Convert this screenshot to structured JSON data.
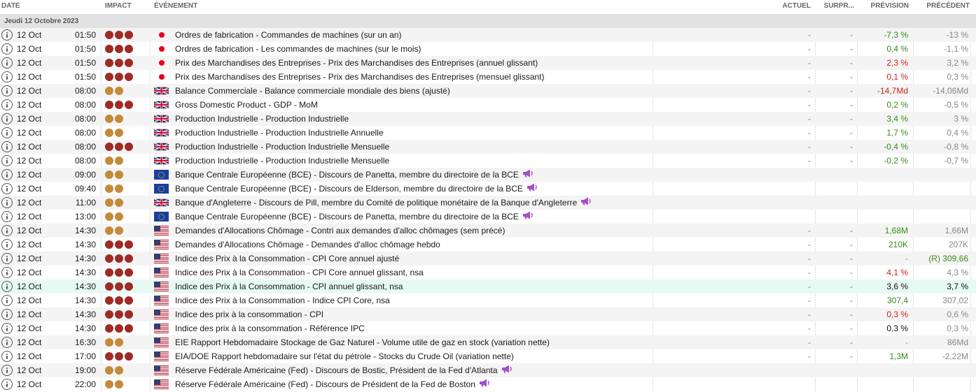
{
  "header": {
    "date": "DATE",
    "impact": "IMPACT",
    "event": "ÉVÉNEMENT",
    "actual": "ACTUEL",
    "surprise": "SURPR...",
    "forecast": "PRÉVISION",
    "previous": "PRÉCÉDENT"
  },
  "day_label": "Jeudi 12 Octobre 2023",
  "colors": {
    "impact_high": "#9e2b25",
    "impact_medium": "#c48a3a",
    "positive": "#3a8b19",
    "negative": "#d0211b",
    "speech_icon": "#a64ec8",
    "highlight_row": "#e6faf3"
  },
  "events": [
    {
      "date": "12 Oct",
      "time": "01:50",
      "impact": 3,
      "flag": "jp",
      "event": "Ordres de fabrication - Commandes de machines (sur un an)",
      "speech": false,
      "actual": "-",
      "surprise": "-",
      "forecast": "-7,3 %",
      "forecast_tone": "pos",
      "previous": "-13 %",
      "previous_tone": "muted"
    },
    {
      "date": "12 Oct",
      "time": "01:50",
      "impact": 3,
      "flag": "jp",
      "event": "Ordres de fabrication - Les commandes de machines (sur le mois)",
      "speech": false,
      "actual": "-",
      "surprise": "-",
      "forecast": "0,4 %",
      "forecast_tone": "pos",
      "previous": "-1,1 %",
      "previous_tone": "muted"
    },
    {
      "date": "12 Oct",
      "time": "01:50",
      "impact": 3,
      "flag": "jp",
      "event": "Prix des Marchandises des Entreprises - Prix des Marchandises des Entreprises (annuel glissant)",
      "speech": false,
      "actual": "-",
      "surprise": "-",
      "forecast": "2,3 %",
      "forecast_tone": "neg",
      "previous": "3,2 %",
      "previous_tone": "muted"
    },
    {
      "date": "12 Oct",
      "time": "01:50",
      "impact": 3,
      "flag": "jp",
      "event": "Prix des Marchandises des Entreprises - Prix des Marchandises des Entreprises (mensuel glissant)",
      "speech": false,
      "actual": "-",
      "surprise": "-",
      "forecast": "0,1 %",
      "forecast_tone": "neg",
      "previous": "0,3 %",
      "previous_tone": "muted"
    },
    {
      "date": "12 Oct",
      "time": "08:00",
      "impact": 2,
      "flag": "uk",
      "event": "Balance Commerciale - Balance commerciale mondiale des biens (ajusté)",
      "speech": false,
      "actual": "-",
      "surprise": "-",
      "forecast": "-14,7Md",
      "forecast_tone": "neg",
      "previous": "-14,06Md",
      "previous_tone": "muted"
    },
    {
      "date": "12 Oct",
      "time": "08:00",
      "impact": 3,
      "flag": "uk",
      "event": "Gross Domestic Product - GDP - MoM",
      "speech": false,
      "actual": "-",
      "surprise": "-",
      "forecast": "0,2 %",
      "forecast_tone": "pos",
      "previous": "-0,5 %",
      "previous_tone": "muted"
    },
    {
      "date": "12 Oct",
      "time": "08:00",
      "impact": 2,
      "flag": "uk",
      "event": "Production Industrielle - Production Industrielle",
      "speech": false,
      "actual": "-",
      "surprise": "-",
      "forecast": "3,4 %",
      "forecast_tone": "pos",
      "previous": "3 %",
      "previous_tone": "muted"
    },
    {
      "date": "12 Oct",
      "time": "08:00",
      "impact": 2,
      "flag": "uk",
      "event": "Production Industrielle - Production Industrielle Annuelle",
      "speech": false,
      "actual": "-",
      "surprise": "-",
      "forecast": "1,7 %",
      "forecast_tone": "pos",
      "previous": "0,4 %",
      "previous_tone": "muted"
    },
    {
      "date": "12 Oct",
      "time": "08:00",
      "impact": 3,
      "flag": "uk",
      "event": "Production Industrielle - Production Industrielle Mensuelle",
      "speech": false,
      "actual": "-",
      "surprise": "-",
      "forecast": "-0,4 %",
      "forecast_tone": "pos",
      "previous": "-0,8 %",
      "previous_tone": "muted"
    },
    {
      "date": "12 Oct",
      "time": "08:00",
      "impact": 2,
      "flag": "uk",
      "event": "Production Industrielle - Production Industrielle Mensuelle",
      "speech": false,
      "actual": "-",
      "surprise": "-",
      "forecast": "-0,2 %",
      "forecast_tone": "pos",
      "previous": "-0,7 %",
      "previous_tone": "muted"
    },
    {
      "date": "12 Oct",
      "time": "09:00",
      "impact": 2,
      "flag": "eu",
      "event": "Banque Centrale Européenne (BCE) - Discours de Panetta, membre du directoire de la BCE",
      "speech": true,
      "actual": "",
      "surprise": "",
      "forecast": "",
      "forecast_tone": "neu",
      "previous": "",
      "previous_tone": "muted"
    },
    {
      "date": "12 Oct",
      "time": "09:40",
      "impact": 2,
      "flag": "eu",
      "event": "Banque Centrale Européenne (BCE) - Discours de Elderson, membre du directoire de la BCE",
      "speech": true,
      "actual": "",
      "surprise": "",
      "forecast": "",
      "forecast_tone": "neu",
      "previous": "",
      "previous_tone": "muted"
    },
    {
      "date": "12 Oct",
      "time": "11:00",
      "impact": 2,
      "flag": "uk",
      "event": "Banque d'Angleterre - Discours de Pill, membre du Comité de politique monétaire de la Banque d'Angleterre",
      "speech": true,
      "actual": "",
      "surprise": "",
      "forecast": "",
      "forecast_tone": "neu",
      "previous": "",
      "previous_tone": "muted"
    },
    {
      "date": "12 Oct",
      "time": "13:00",
      "impact": 2,
      "flag": "eu",
      "event": "Banque Centrale Européenne (BCE) - Discours de Panetta, membre du directoire de la BCE",
      "speech": true,
      "actual": "",
      "surprise": "",
      "forecast": "",
      "forecast_tone": "neu",
      "previous": "",
      "previous_tone": "muted"
    },
    {
      "date": "12 Oct",
      "time": "14:30",
      "impact": 2,
      "flag": "us",
      "event": "Demandes d'Allocations Chômage - Contri aux demandes d'alloc chômages (sem précé)",
      "speech": false,
      "actual": "-",
      "surprise": "-",
      "forecast": "1,68M",
      "forecast_tone": "pos",
      "previous": "1,66M",
      "previous_tone": "muted"
    },
    {
      "date": "12 Oct",
      "time": "14:30",
      "impact": 3,
      "flag": "us",
      "event": "Demandes d'Allocations Chômage - Demandes d'alloc chômage hebdo",
      "speech": false,
      "actual": "-",
      "surprise": "-",
      "forecast": "210K",
      "forecast_tone": "pos",
      "previous": "207K",
      "previous_tone": "muted"
    },
    {
      "date": "12 Oct",
      "time": "14:30",
      "impact": 3,
      "flag": "us",
      "event": "Indice des Prix à la Consommation - CPI Core annuel ajusté",
      "speech": false,
      "actual": "-",
      "surprise": "-",
      "forecast": "-",
      "forecast_tone": "muted",
      "previous": "(R) 309,66",
      "previous_tone": "pos"
    },
    {
      "date": "12 Oct",
      "time": "14:30",
      "impact": 3,
      "flag": "us",
      "event": "Indice des Prix à la Consommation - CPI Core annuel glissant, nsa",
      "speech": false,
      "actual": "-",
      "surprise": "-",
      "forecast": "4,1 %",
      "forecast_tone": "neg",
      "previous": "4,3 %",
      "previous_tone": "muted"
    },
    {
      "date": "12 Oct",
      "time": "14:30",
      "impact": 3,
      "flag": "us",
      "event": "Indice des Prix à la Consommation - CPI annuel glissant, nsa",
      "speech": false,
      "actual": "-",
      "surprise": "-",
      "forecast": "3,6 %",
      "forecast_tone": "neu",
      "previous": "3,7 %",
      "previous_tone": "neu",
      "highlight": true
    },
    {
      "date": "12 Oct",
      "time": "14:30",
      "impact": 3,
      "flag": "us",
      "event": "Indice des Prix à la Consommation - Indice CPI Core, nsa",
      "speech": false,
      "actual": "-",
      "surprise": "-",
      "forecast": "307,4",
      "forecast_tone": "pos",
      "previous": "307,02",
      "previous_tone": "muted"
    },
    {
      "date": "12 Oct",
      "time": "14:30",
      "impact": 3,
      "flag": "us",
      "event": "Indice des prix à la consommation - CPI",
      "speech": false,
      "actual": "-",
      "surprise": "-",
      "forecast": "0,3 %",
      "forecast_tone": "neg",
      "previous": "0,6 %",
      "previous_tone": "muted"
    },
    {
      "date": "12 Oct",
      "time": "14:30",
      "impact": 3,
      "flag": "us",
      "event": "Indice des prix à la consommation - Référence IPC",
      "speech": false,
      "actual": "-",
      "surprise": "-",
      "forecast": "0,3 %",
      "forecast_tone": "neu",
      "previous": "0,3 %",
      "previous_tone": "muted"
    },
    {
      "date": "12 Oct",
      "time": "16:30",
      "impact": 2,
      "flag": "us",
      "event": "EIE Rapport Hebdomadaire Stockage de Gaz Naturel - Volume utile de gaz en stock (variation nette)",
      "speech": false,
      "actual": "-",
      "surprise": "-",
      "forecast": "-",
      "forecast_tone": "muted",
      "previous": "86Md",
      "previous_tone": "muted"
    },
    {
      "date": "12 Oct",
      "time": "17:00",
      "impact": 3,
      "flag": "us",
      "event": "EIA/DOE Rapport hebdomadaire sur l'état du pétrole - Stocks du Crude Oil (variation nette)",
      "speech": false,
      "actual": "-",
      "surprise": "-",
      "forecast": "1,3M",
      "forecast_tone": "pos",
      "previous": "-2,22M",
      "previous_tone": "muted"
    },
    {
      "date": "12 Oct",
      "time": "19:00",
      "impact": 2,
      "flag": "us",
      "event": "Réserve Fédérale Américaine (Fed) - Discours de Bostic, Président de la Fed d'Atlanta",
      "speech": true,
      "actual": "",
      "surprise": "",
      "forecast": "",
      "forecast_tone": "neu",
      "previous": "",
      "previous_tone": "muted"
    },
    {
      "date": "12 Oct",
      "time": "22:00",
      "impact": 2,
      "flag": "us",
      "event": "Réserve Fédérale Américaine (Fed) - Discours de Président de la Fed de Boston",
      "speech": true,
      "actual": "",
      "surprise": "",
      "forecast": "",
      "forecast_tone": "neu",
      "previous": "",
      "previous_tone": "muted"
    }
  ]
}
